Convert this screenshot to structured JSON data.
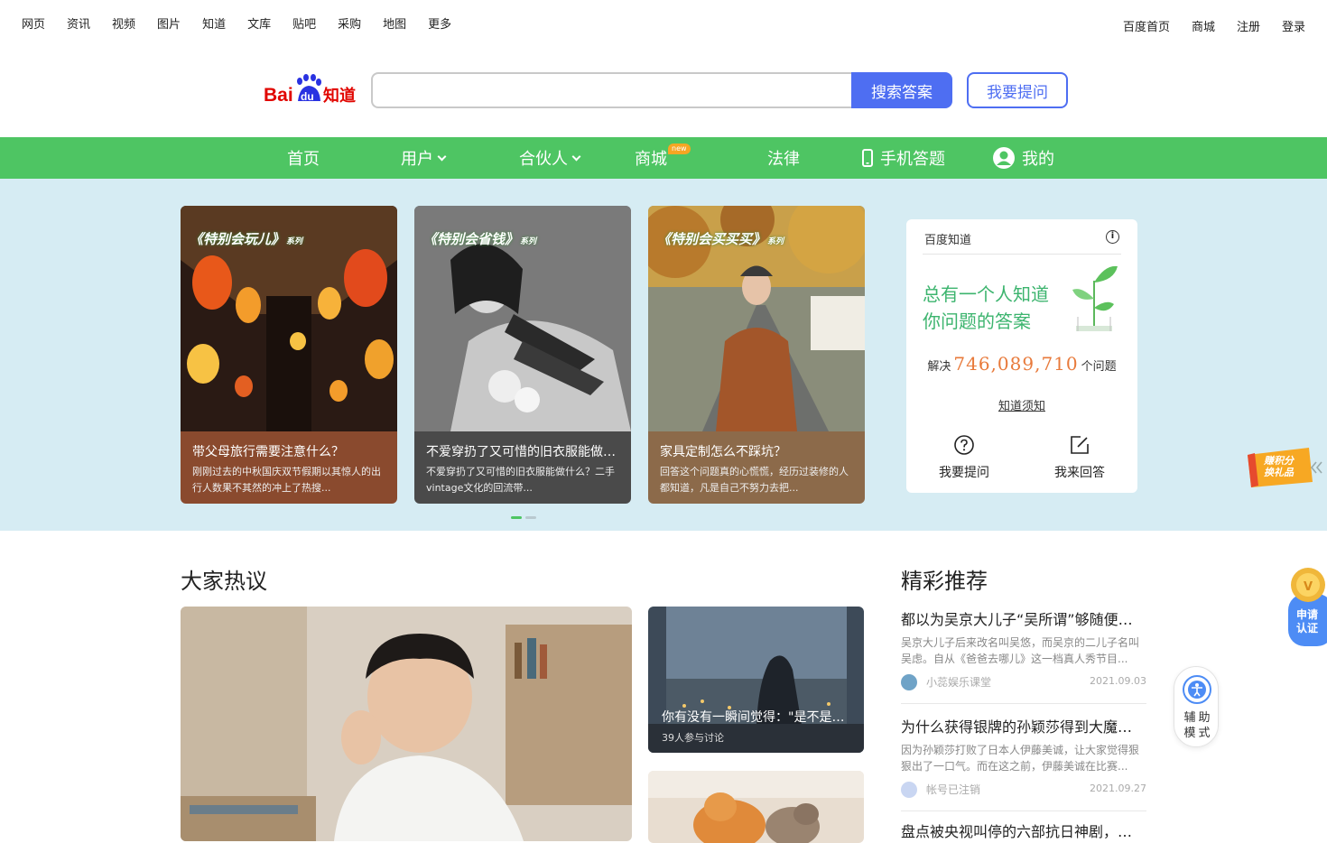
{
  "topbar": {
    "left_links": [
      "网页",
      "资讯",
      "视频",
      "图片",
      "知道",
      "文库",
      "贴吧",
      "采购",
      "地图",
      "更多"
    ],
    "right_links": [
      "百度首页",
      "商城",
      "注册",
      "登录"
    ]
  },
  "logo": {
    "bai": "Bai",
    "du": "du",
    "zhidao": "知道"
  },
  "search": {
    "placeholder": "",
    "value": "",
    "button_label": "搜索答案",
    "ask_label": "我要提问"
  },
  "nav": {
    "home": "首页",
    "user": "用户",
    "partner": "合伙人",
    "mall": "商城",
    "mall_badge": "new",
    "law": "法律",
    "mobile": "手机答题",
    "mine": "我的"
  },
  "banner": {
    "cards": [
      {
        "series": "《特别会玩儿》",
        "series_suffix": "系列",
        "title": "带父母旅行需要注意什么？",
        "desc": "刚刚过去的中秋国庆双节假期以其惊人的出行人数果不其然的冲上了热搜..."
      },
      {
        "series": "《特别会省钱》",
        "series_suffix": "系列",
        "title": "不爱穿扔了又可惜的旧衣服能做什么？",
        "desc": "不爱穿扔了又可惜的旧衣服能做什么？二手vintage文化的回流带..."
      },
      {
        "series": "《特别会买买买》",
        "series_suffix": "系列",
        "title": "家具定制怎么不踩坑？",
        "desc": "回答这个问题真的心慌慌，经历过装修的人都知道，凡是自己不努力去把..."
      }
    ]
  },
  "panel": {
    "header": "百度知道",
    "slogan_line1": "总有一个人知道",
    "slogan_line2": "你问题的答案",
    "solved_prefix": "解决",
    "solved_count": "746,089,710",
    "solved_suffix": "个问题",
    "rules": "知道须知",
    "ask": "我要提问",
    "answer": "我来回答"
  },
  "side": {
    "points_line1": "赚积分",
    "points_line2": "换礼品",
    "apply_line1": "申请",
    "apply_line2": "认证",
    "assist_line1": "辅助",
    "assist_line2": "模式"
  },
  "hot": {
    "title": "大家热议",
    "cards": [
      {
        "title": "你有没有一瞬间觉得：\"是不是长大了就不快乐了\"",
        "sub": "39人参与讨论"
      }
    ]
  },
  "recommend": {
    "title": "精彩推荐",
    "items": [
      {
        "title": "都以为吴京大儿子“吴所谓”够随便，没想到二儿子",
        "desc": "吴京大儿子后来改名叫吴悠，而吴京的二儿子名叫吴虑。自从《爸爸去哪儿》这一档真人秀节目...",
        "author": "小蕊娱乐课堂",
        "date": "2021.09.03"
      },
      {
        "title": "为什么获得银牌的孙颖莎得到大魔王的拥抱",
        "desc": "因为孙颖莎打败了日本人伊藤美诚，让大家觉得狠狠出了一口气。而在这之前，伊藤美诚在比赛...",
        "author": "帐号已注销",
        "date": "2021.09.27"
      },
      {
        "title": "盘点被央视叫停的六部抗日神剧，每一部都",
        "desc": "",
        "author": "",
        "date": ""
      }
    ]
  },
  "colors": {
    "brand_blue": "#4e6ef2",
    "nav_green": "#4ec563",
    "banner_bg": "#d6ecf3",
    "slogan_green": "#3cb46e",
    "count_orange": "#e87a3b"
  }
}
